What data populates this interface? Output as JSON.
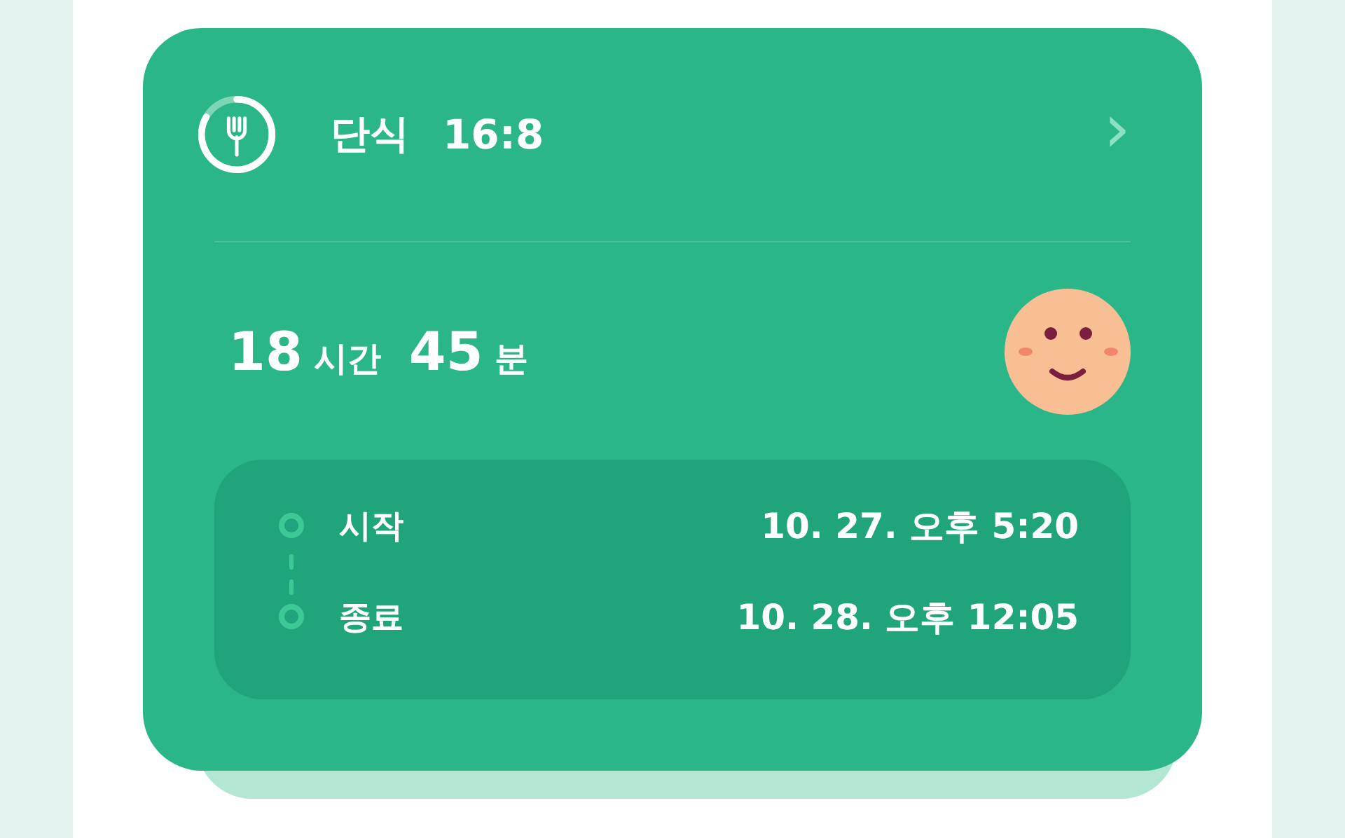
{
  "header": {
    "title": "단식",
    "plan": "16:8",
    "chevron": "›"
  },
  "duration": {
    "hours": "18",
    "hours_unit": "시간",
    "minutes": "45",
    "minutes_unit": "분"
  },
  "timeline": [
    {
      "label": "시작",
      "time": "10. 27. 오후 5:20"
    },
    {
      "label": "종료",
      "time": "10. 28. 오후 12:05"
    }
  ]
}
